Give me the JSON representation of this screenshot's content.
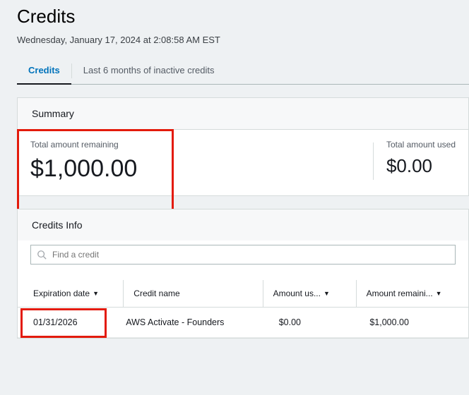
{
  "header": {
    "title": "Credits",
    "timestamp": "Wednesday, January 17, 2024 at 2:08:58 AM EST"
  },
  "tabs": {
    "active": "Credits",
    "inactive": "Last 6 months of inactive credits"
  },
  "summary": {
    "title": "Summary",
    "remaining_label": "Total amount remaining",
    "remaining_value": "$1,000.00",
    "used_label": "Total amount used",
    "used_value": "$0.00"
  },
  "credits_info": {
    "title": "Credits Info",
    "search_placeholder": "Find a credit",
    "columns": {
      "expiration": "Expiration date",
      "name": "Credit name",
      "used": "Amount us...",
      "remaining": "Amount remaini..."
    },
    "rows": [
      {
        "expiration": "01/31/2026",
        "name": "AWS Activate - Founders",
        "used": "$0.00",
        "remaining": "$1,000.00"
      }
    ]
  }
}
